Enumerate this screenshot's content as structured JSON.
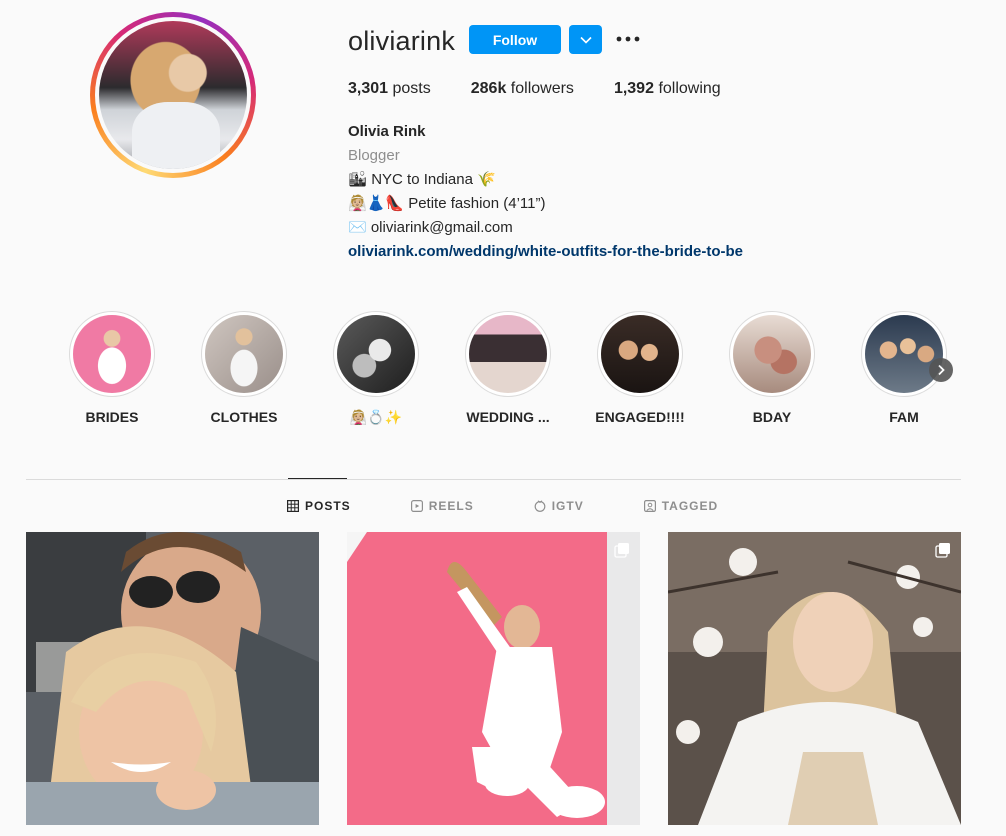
{
  "profile": {
    "username": "oliviarink",
    "follow_label": "Follow",
    "stats": {
      "posts_count": "3,301",
      "posts_label": "posts",
      "followers_count": "286k",
      "followers_label": "followers",
      "following_count": "1,392",
      "following_label": "following"
    },
    "bio": {
      "name": "Olivia Rink",
      "category": "Blogger",
      "line1": "🏙 NYC to Indiana 🌾",
      "line2": "👰🏼👗👠 Petite fashion (4’11”)",
      "line3": "✉️ oliviarink@gmail.com",
      "link": "oliviarink.com/wedding/white-outfits-for-the-bride-to-be"
    }
  },
  "highlights": [
    {
      "label": "BRIDES"
    },
    {
      "label": "CLOTHES"
    },
    {
      "label": "👰🏼💍✨"
    },
    {
      "label": "WEDDING ..."
    },
    {
      "label": "ENGAGED!!!!"
    },
    {
      "label": "BDAY"
    },
    {
      "label": "FAM"
    }
  ],
  "tabs": [
    {
      "label": "POSTS",
      "icon": "grid-icon",
      "active": true
    },
    {
      "label": "REELS",
      "icon": "reels-icon"
    },
    {
      "label": "IGTV",
      "icon": "igtv-icon"
    },
    {
      "label": "TAGGED",
      "icon": "tagged-icon"
    }
  ],
  "posts": [
    {
      "multi": false
    },
    {
      "multi": true
    },
    {
      "multi": true
    }
  ],
  "colors": {
    "accent": "#0095f6",
    "link": "#00376b",
    "muted": "#8e8e8e"
  }
}
